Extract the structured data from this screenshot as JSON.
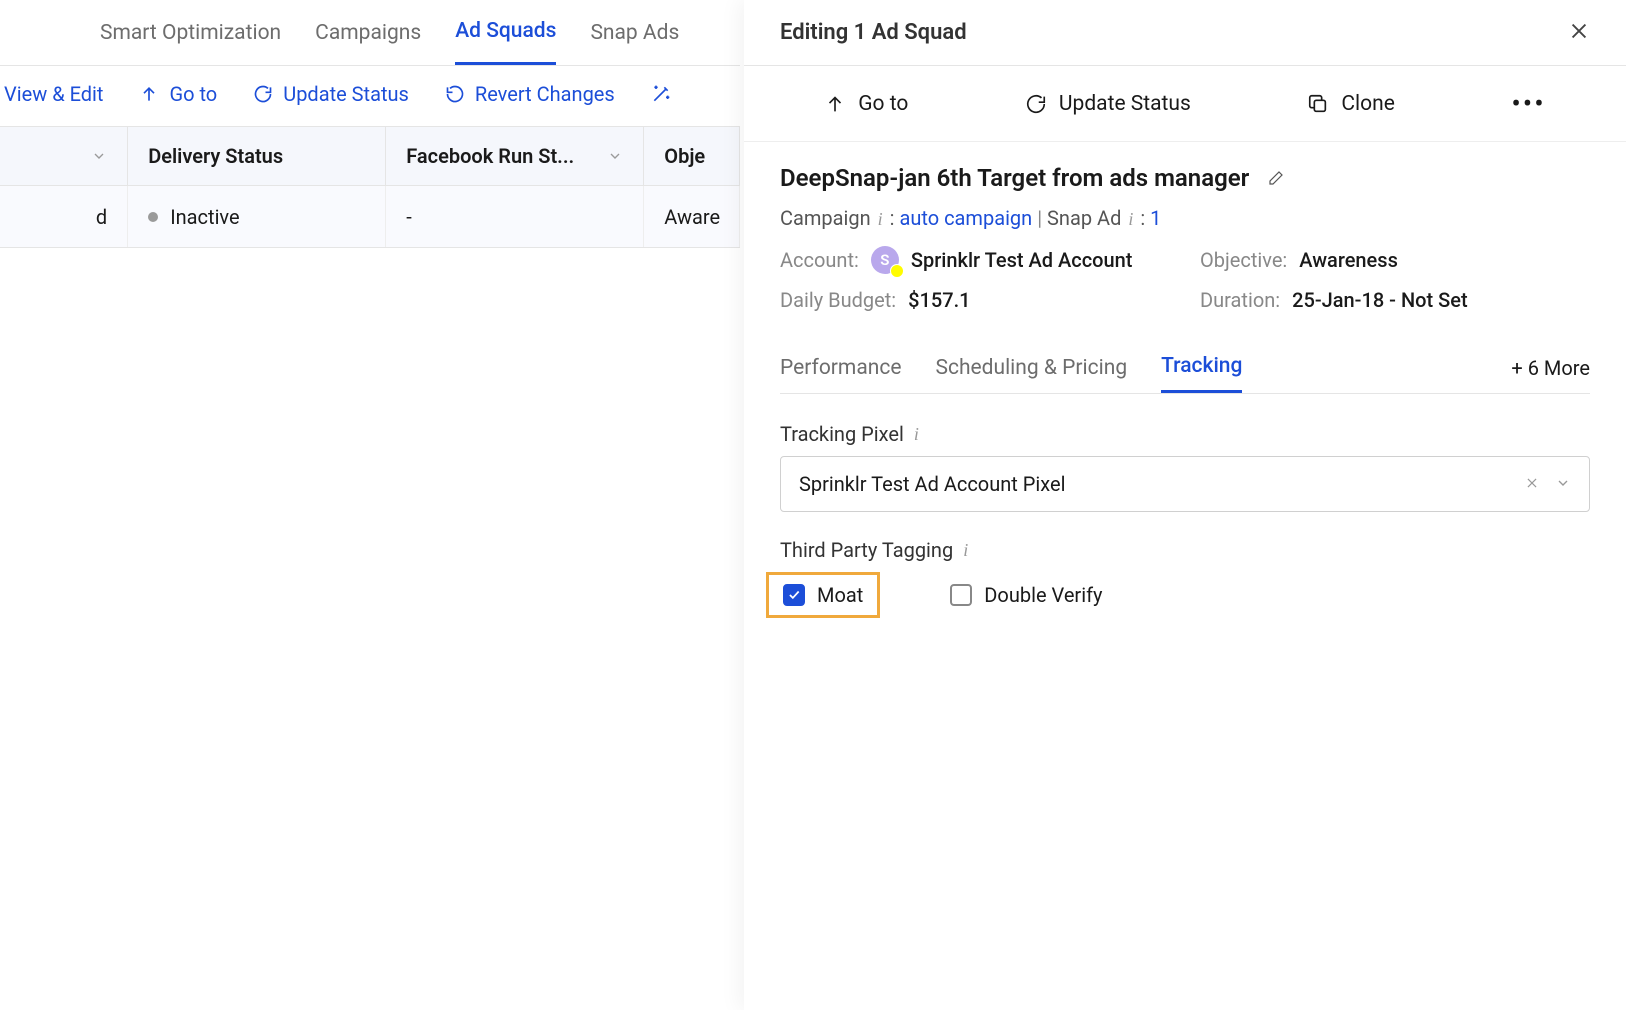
{
  "top_tabs": {
    "items": [
      "Smart Optimization",
      "Campaigns",
      "Ad Squads",
      "Snap Ads"
    ],
    "active_index": 2
  },
  "toolbar": {
    "view_edit": "View & Edit",
    "go_to": "Go to",
    "update_status": "Update Status",
    "revert_changes": "Revert Changes"
  },
  "table": {
    "columns": [
      "",
      "Delivery Status",
      "Facebook Run St...",
      "Obje"
    ],
    "row": {
      "cell0": "d",
      "status": "Inactive",
      "fb_run": "-",
      "objective": "Aware"
    }
  },
  "panel": {
    "header_title": "Editing 1 Ad Squad",
    "actions": {
      "go_to": "Go to",
      "update_status": "Update Status",
      "clone": "Clone"
    },
    "entity_name": "DeepSnap-jan 6th Target from ads manager",
    "meta": {
      "campaign_label": "Campaign",
      "campaign_value": "auto campaign",
      "snapad_label": "Snap Ad",
      "snapad_value": "1"
    },
    "kv": {
      "account_label": "Account:",
      "account_value": "Sprinklr Test Ad Account",
      "avatar_initial": "S",
      "objective_label": "Objective:",
      "objective_value": "Awareness",
      "budget_label": "Daily Budget:",
      "budget_value": "$157.1",
      "duration_label": "Duration:",
      "duration_value": "25-Jan-18 - Not Set"
    },
    "sub_tabs": {
      "items": [
        "Performance",
        "Scheduling & Pricing",
        "Tracking"
      ],
      "more_label": "+ 6 More",
      "active_index": 2
    },
    "tracking": {
      "pixel_label": "Tracking Pixel",
      "pixel_value": "Sprinklr Test Ad Account Pixel",
      "tagging_label": "Third Party Tagging",
      "moat": "Moat",
      "dv": "Double Verify",
      "moat_checked": true,
      "dv_checked": false
    }
  }
}
